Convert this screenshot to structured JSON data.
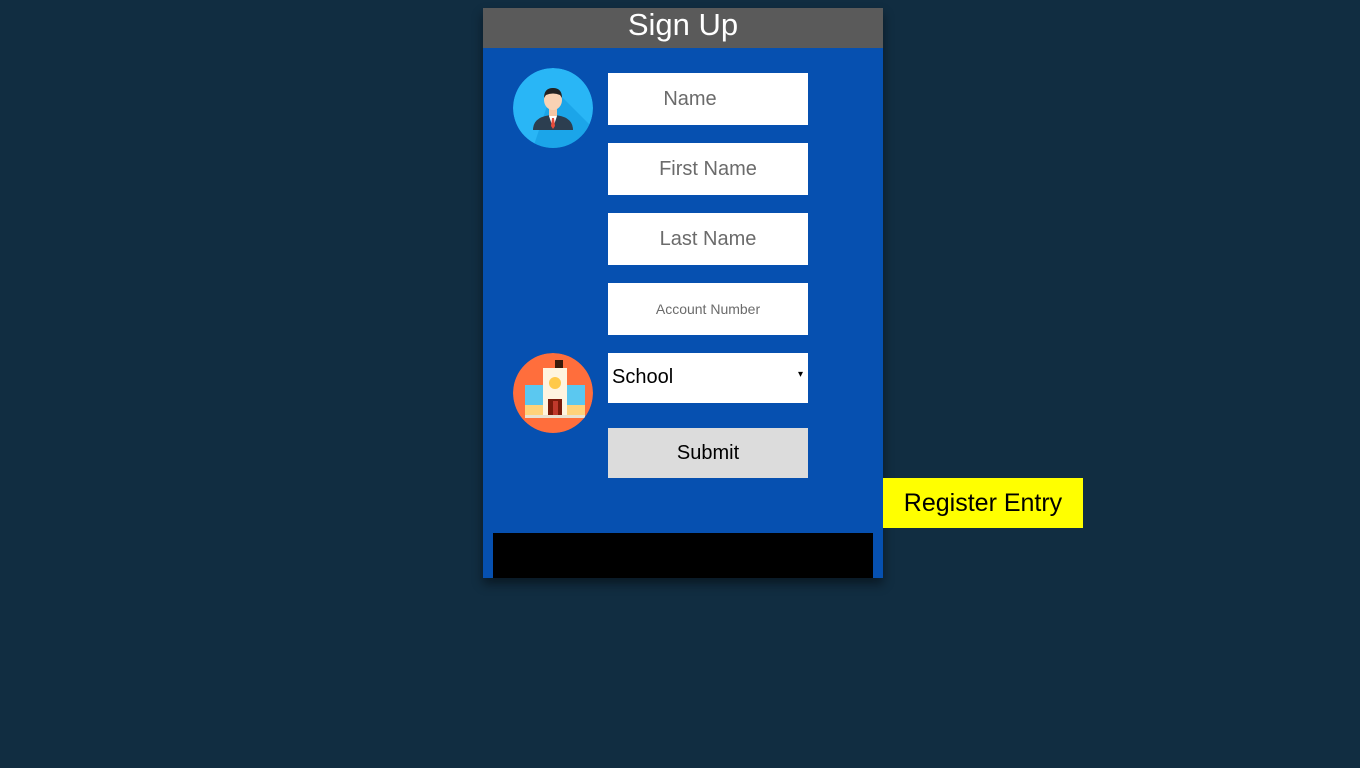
{
  "form": {
    "title": "Sign Up",
    "fields": {
      "name_placeholder": "Name",
      "first_name_placeholder": "First Name",
      "last_name_placeholder": "Last Name",
      "account_number_placeholder": "Account Number"
    },
    "school_select": {
      "selected": "School",
      "arrow": "▾"
    },
    "submit_label": "Submit"
  },
  "register_button_label": "Register Entry",
  "icons": {
    "user": "user-avatar-icon",
    "school": "school-building-icon"
  },
  "colors": {
    "page_background": "#112d41",
    "card_background": "#0650b0",
    "header_background": "#5a5a5a",
    "register_button": "#ffff00",
    "submit_button": "#dcdcdc"
  }
}
